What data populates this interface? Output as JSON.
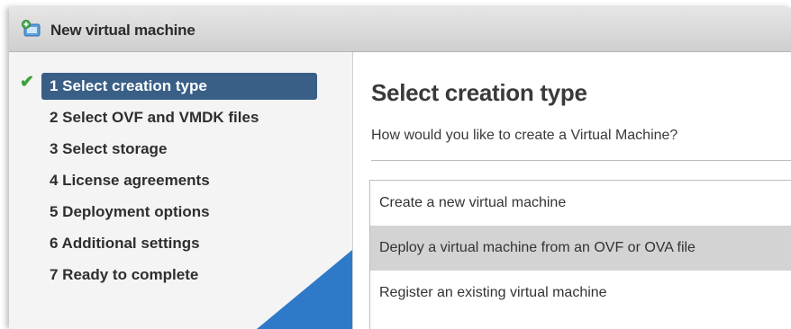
{
  "window": {
    "title": "New virtual machine",
    "icon": "new-vm-icon"
  },
  "sidebar": {
    "steps": [
      {
        "label": "1 Select creation type",
        "active": true,
        "completed": true
      },
      {
        "label": "2 Select OVF and VMDK files",
        "active": false,
        "completed": false
      },
      {
        "label": "3 Select storage",
        "active": false,
        "completed": false
      },
      {
        "label": "4 License agreements",
        "active": false,
        "completed": false
      },
      {
        "label": "5 Deployment options",
        "active": false,
        "completed": false
      },
      {
        "label": "6 Additional settings",
        "active": false,
        "completed": false
      },
      {
        "label": "7 Ready to complete",
        "active": false,
        "completed": false
      }
    ],
    "check_glyph": "✔"
  },
  "main": {
    "heading": "Select creation type",
    "question": "How would you like to create a Virtual Machine?",
    "options": [
      {
        "label": "Create a new virtual machine",
        "selected": false
      },
      {
        "label": "Deploy a virtual machine from an OVF or OVA file",
        "selected": true
      },
      {
        "label": "Register an existing virtual machine",
        "selected": false
      }
    ]
  },
  "colors": {
    "active_step": "#3a5f87",
    "selected_option": "#d3d3d3",
    "corner_accent": "#2f7ac8",
    "check": "#3aa13a"
  }
}
